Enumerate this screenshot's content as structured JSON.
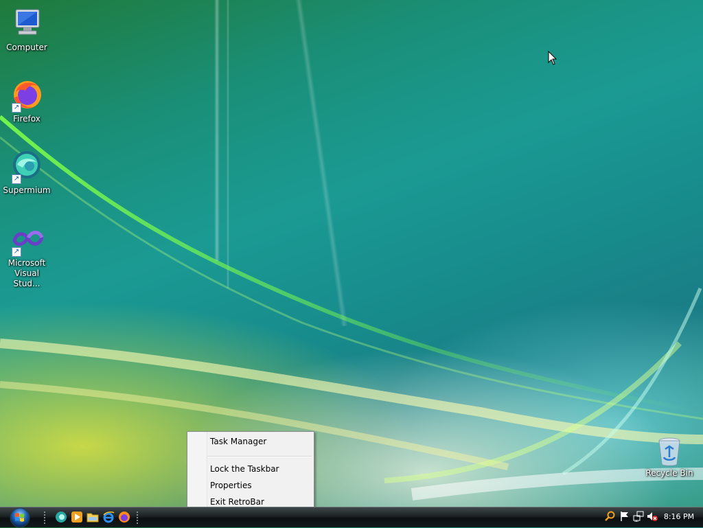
{
  "desktop": {
    "icons": [
      {
        "label": "Computer"
      },
      {
        "label": "Firefox"
      },
      {
        "label": "Supermium"
      },
      {
        "label": "Microsoft Visual Stud..."
      },
      {
        "label": "Recycle Bin"
      }
    ]
  },
  "context_menu": {
    "items": [
      {
        "label": "Task Manager"
      },
      {
        "label": "Lock the Taskbar"
      },
      {
        "label": "Properties"
      },
      {
        "label": "Exit RetroBar"
      }
    ]
  },
  "taskbar": {
    "quick_launch": [
      "supermium-icon",
      "media-player-icon",
      "file-explorer-icon",
      "internet-explorer-icon",
      "firefox-icon"
    ],
    "tray": [
      "search-icon",
      "action-center-flag-icon",
      "network-icon",
      "volume-muted-icon"
    ],
    "clock": "8:16 PM"
  },
  "colors": {
    "taskbar": "#141a1c",
    "menu_background": "#f1f1f1",
    "accent": "#1b9a93"
  }
}
